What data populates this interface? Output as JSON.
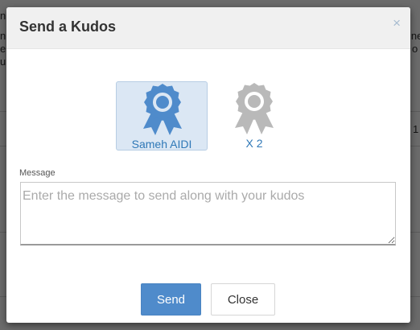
{
  "background": {
    "fragments": [
      "n",
      "n",
      "e",
      "u",
      "ine",
      "o",
      "1"
    ]
  },
  "modal": {
    "title": "Send a Kudos",
    "close_icon": "×",
    "badges": [
      {
        "label": "Sameh AIDI",
        "selected": true,
        "color": "#4f8bcb",
        "icon": "award-ribbon-icon"
      },
      {
        "label": "X 2",
        "selected": false,
        "color": "#b9b9b9",
        "icon": "award-ribbon-icon"
      }
    ],
    "message": {
      "label": "Message",
      "placeholder": "Enter the message to send along with your kudos",
      "value": ""
    },
    "buttons": {
      "send_label": "Send",
      "close_label": "Close"
    }
  },
  "colors": {
    "accent": "#4f8bcb",
    "link": "#2f78b7",
    "inactive_icon": "#b9b9b9"
  }
}
